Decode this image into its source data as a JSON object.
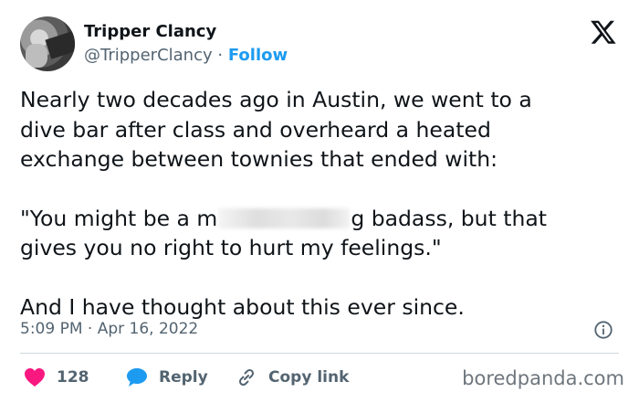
{
  "author": {
    "name": "Tripper Clancy",
    "handle": "@TripperClancy",
    "separator": "·",
    "follow_label": "Follow"
  },
  "tweet": {
    "lines_p1": [
      "Nearly two decades ago in Austin, we went to a",
      "dive bar after class and overheard a heated",
      "exchange between townies that ended with:"
    ],
    "quote_line1_start": "\"You might be a m",
    "quote_line1_end": "g badass, but that",
    "quote_line2": "gives you no right to hurt my feelings.\"",
    "closing": "And I have thought about this ever since."
  },
  "timestamp": "5:09 PM · Apr 16, 2022",
  "actions": {
    "like_count": "128",
    "reply_label": "Reply",
    "copy_label": "Copy link"
  },
  "watermark": "boredpanda.com",
  "icons": {
    "like": "heart-icon",
    "reply": "speech-bubble-icon",
    "copy": "link-icon",
    "info": "info-icon",
    "platform": "x-logo-icon"
  },
  "colors": {
    "accent": "#1d9bf0",
    "like": "#f91880",
    "text": "#0f1419",
    "muted": "#536471"
  }
}
